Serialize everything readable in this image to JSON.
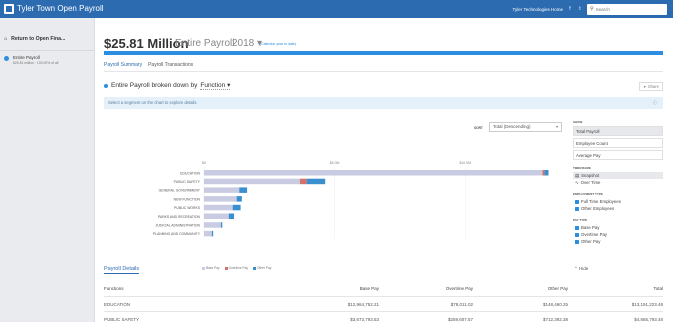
{
  "topbar": {
    "app_title": "Tyler Town Open Payroll",
    "home_link": "Tyler Technologies Home",
    "search_placeholder": "Search",
    "social": [
      "f",
      "t"
    ]
  },
  "sidebar": {
    "return_label": "Return to Open Fina...",
    "items": [
      {
        "label": "Entire Payroll",
        "sub": "$25.81 million · 100.00% of all"
      }
    ]
  },
  "header": {
    "amount": "$25.81 Million",
    "scope": "Entire Payroll",
    "year": "2018",
    "calendar_note": "(Calendar year to date)"
  },
  "tabs": [
    {
      "label": "Payroll Summary",
      "active": true
    },
    {
      "label": "Payroll Transactions",
      "active": false
    }
  ],
  "breakdown": {
    "label": "Entire Payroll broken down by",
    "by": "Function",
    "share_label": "Share"
  },
  "hint": "Select a segment on the chart to explore details",
  "sort": {
    "label": "SORT",
    "value": "Total (Descending)"
  },
  "panel": {
    "show_title": "SHOW",
    "show_options": [
      {
        "label": "Total Payroll",
        "selected": true
      },
      {
        "label": "Employee Count",
        "selected": false
      },
      {
        "label": "Average Pay",
        "selected": false
      }
    ],
    "timeframe_title": "TIMEFRAME",
    "timeframe_options": [
      {
        "label": "Snapshot",
        "icon": "bar-chart-icon",
        "selected": true
      },
      {
        "label": "Over Time",
        "icon": "line-chart-icon",
        "selected": false
      }
    ],
    "employment_title": "EMPLOYMENT TYPE",
    "employment_options": [
      "Full Time Employees",
      "Other Employees"
    ],
    "paytype_title": "PAY TYPE",
    "paytype_options": [
      "Base Pay",
      "Overtime Pay",
      "Other Pay"
    ]
  },
  "chart_data": {
    "type": "bar",
    "orientation": "horizontal",
    "stacked": true,
    "categories": [
      "EDUCATION",
      "PUBLIC SAFETY",
      "GENERAL GOVERNMENT",
      "NEW FUNCTION",
      "PUBLIC WORKS",
      "PARKS AND RECREATION",
      "JUDICIAL ADMINISTRATION",
      "PLANNING AND COMMUNITY"
    ],
    "series": [
      {
        "name": "Base Pay",
        "color": "#c9cbe3",
        "values": [
          12.96,
          3.67,
          1.35,
          1.25,
          1.1,
          0.95,
          0.65,
          0.3
        ]
      },
      {
        "name": "Overtime Pay",
        "color": "#d1736b",
        "values": [
          0.08,
          0.26,
          0.0,
          0.0,
          0.0,
          0.0,
          0.0,
          0.0
        ]
      },
      {
        "name": "Other Pay",
        "color": "#3a8fce",
        "values": [
          0.15,
          0.71,
          0.3,
          0.2,
          0.3,
          0.2,
          0.05,
          0.05
        ]
      }
    ],
    "xticks": [
      "$0",
      "$5.0M",
      "$10.0M"
    ],
    "xtick_values": [
      0,
      5,
      10
    ],
    "xlim": [
      0,
      13.4
    ],
    "legend": "bottom"
  },
  "details": {
    "title": "Payroll Details",
    "hide_label": "Hide",
    "columns": [
      "Functions",
      "Base Pay",
      "Overtime Pay",
      "Other Pay",
      "Total"
    ],
    "rows": [
      [
        "EDUCATION",
        "$12,964,752.21",
        "$78,011.02",
        "$148,460.25",
        "$13,191,223.48"
      ],
      [
        "PUBLIC SAFETY",
        "$3,673,793.53",
        "$259,607.57",
        "$712,392.38",
        "$4,665,793.48"
      ]
    ]
  }
}
